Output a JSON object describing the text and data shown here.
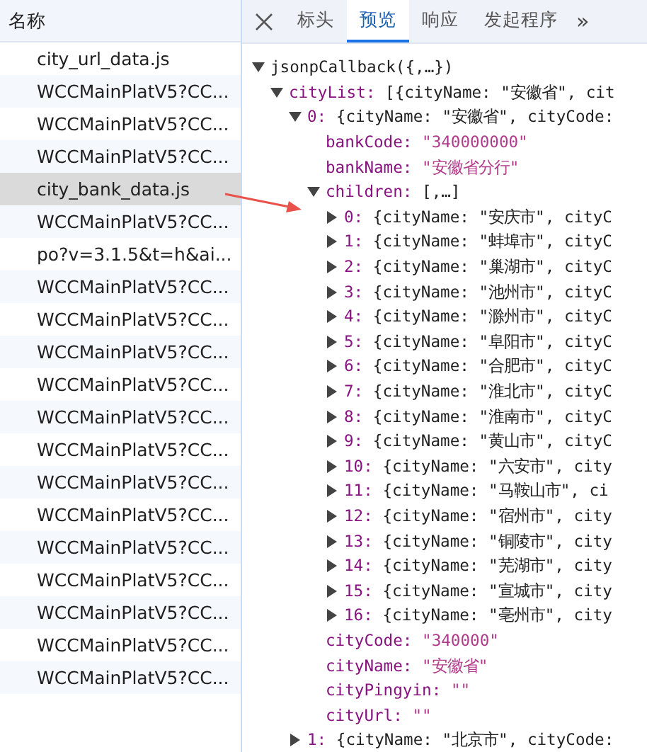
{
  "sidebar": {
    "header": "名称",
    "items": [
      {
        "label": "city_url_data.js",
        "selected": false
      },
      {
        "label": "WCCMainPlatV5?CC...",
        "selected": false
      },
      {
        "label": "WCCMainPlatV5?CC...",
        "selected": false
      },
      {
        "label": "WCCMainPlatV5?CC...",
        "selected": false
      },
      {
        "label": "city_bank_data.js",
        "selected": true
      },
      {
        "label": "WCCMainPlatV5?CC...",
        "selected": false
      },
      {
        "label": "po?v=3.1.5&t=h&ai...",
        "selected": false
      },
      {
        "label": "WCCMainPlatV5?CC...",
        "selected": false
      },
      {
        "label": "WCCMainPlatV5?CC...",
        "selected": false
      },
      {
        "label": "WCCMainPlatV5?CC...",
        "selected": false
      },
      {
        "label": "WCCMainPlatV5?CC...",
        "selected": false
      },
      {
        "label": "WCCMainPlatV5?CC...",
        "selected": false
      },
      {
        "label": "WCCMainPlatV5?CC...",
        "selected": false
      },
      {
        "label": "WCCMainPlatV5?CC...",
        "selected": false
      },
      {
        "label": "WCCMainPlatV5?CC...",
        "selected": false
      },
      {
        "label": "WCCMainPlatV5?CC...",
        "selected": false
      },
      {
        "label": "WCCMainPlatV5?CC...",
        "selected": false
      },
      {
        "label": "WCCMainPlatV5?CC...",
        "selected": false
      },
      {
        "label": "WCCMainPlatV5?CC...",
        "selected": false
      },
      {
        "label": "WCCMainPlatV5?CC...",
        "selected": false
      }
    ]
  },
  "tabs": [
    {
      "label": "标头",
      "selected": false
    },
    {
      "label": "预览",
      "selected": true
    },
    {
      "label": "响应",
      "selected": false
    },
    {
      "label": "发起程序",
      "selected": false
    }
  ],
  "more_tabs": "»",
  "tree": [
    {
      "label": "jsonpCallback({,…})",
      "expanded": true,
      "children": [
        {
          "key": "cityList:",
          "value": "[{cityName: \"安徽省\", cit",
          "expanded": true,
          "children": [
            {
              "key": "0:",
              "value": "{cityName: \"安徽省\", cityCode:",
              "expanded": true,
              "children": [
                {
                  "key": "bankCode:",
                  "value": "\"340000000\""
                },
                {
                  "key": "bankName:",
                  "value": "\"安徽省分行\""
                },
                {
                  "key": "children:",
                  "value": "[,…]",
                  "expanded": true,
                  "children": [
                    {
                      "key": "0:",
                      "value": "{cityName: \"安庆市\", cityC",
                      "expanded": false
                    },
                    {
                      "key": "1:",
                      "value": "{cityName: \"蚌埠市\", cityC",
                      "expanded": false
                    },
                    {
                      "key": "2:",
                      "value": "{cityName: \"巢湖市\", cityC",
                      "expanded": false
                    },
                    {
                      "key": "3:",
                      "value": "{cityName: \"池州市\", cityC",
                      "expanded": false
                    },
                    {
                      "key": "4:",
                      "value": "{cityName: \"滁州市\", cityC",
                      "expanded": false
                    },
                    {
                      "key": "5:",
                      "value": "{cityName: \"阜阳市\", cityC",
                      "expanded": false
                    },
                    {
                      "key": "6:",
                      "value": "{cityName: \"合肥市\", cityC",
                      "expanded": false
                    },
                    {
                      "key": "7:",
                      "value": "{cityName: \"淮北市\", cityC",
                      "expanded": false
                    },
                    {
                      "key": "8:",
                      "value": "{cityName: \"淮南市\", cityC",
                      "expanded": false
                    },
                    {
                      "key": "9:",
                      "value": "{cityName: \"黄山市\", cityC",
                      "expanded": false
                    },
                    {
                      "key": "10:",
                      "value": "{cityName: \"六安市\", city",
                      "expanded": false
                    },
                    {
                      "key": "11:",
                      "value": "{cityName: \"马鞍山市\", ci",
                      "expanded": false
                    },
                    {
                      "key": "12:",
                      "value": "{cityName: \"宿州市\", city",
                      "expanded": false
                    },
                    {
                      "key": "13:",
                      "value": "{cityName: \"铜陵市\", city",
                      "expanded": false
                    },
                    {
                      "key": "14:",
                      "value": "{cityName: \"芜湖市\", city",
                      "expanded": false
                    },
                    {
                      "key": "15:",
                      "value": "{cityName: \"宣城市\", city",
                      "expanded": false
                    },
                    {
                      "key": "16:",
                      "value": "{cityName: \"亳州市\", city",
                      "expanded": false
                    }
                  ]
                },
                {
                  "key": "cityCode:",
                  "value": "\"340000\""
                },
                {
                  "key": "cityName:",
                  "value": "\"安徽省\""
                },
                {
                  "key": "cityPingyin:",
                  "value": "\"\""
                },
                {
                  "key": "cityUrl:",
                  "value": "\"\""
                }
              ]
            },
            {
              "key": "1:",
              "value": "{cityName: \"北京市\", cityCode:",
              "expanded": false
            }
          ]
        }
      ]
    }
  ]
}
